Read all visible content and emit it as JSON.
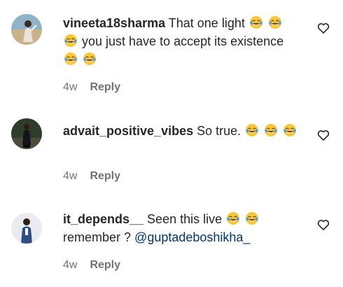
{
  "comments": [
    {
      "username": "vineeta18sharma",
      "segments": [
        {
          "t": "text",
          "v": " That one light "
        },
        {
          "t": "emoji",
          "name": "face-with-tears-of-joy"
        },
        {
          "t": "text",
          "v": " "
        },
        {
          "t": "emoji",
          "name": "face-with-tears-of-joy"
        },
        {
          "t": "text",
          "v": " "
        },
        {
          "t": "emoji",
          "name": "face-with-tears-of-joy"
        },
        {
          "t": "text",
          "v": " you just have to accept its existence "
        },
        {
          "t": "emoji",
          "name": "face-with-tears-of-joy"
        },
        {
          "t": "text",
          "v": " "
        },
        {
          "t": "emoji",
          "name": "face-with-tears-of-joy"
        }
      ],
      "time": "4w",
      "reply_label": "Reply",
      "like_icon": "heart-outline-icon"
    },
    {
      "username": "advait_positive_vibes",
      "segments": [
        {
          "t": "text",
          "v": " So true. "
        },
        {
          "t": "emoji",
          "name": "face-with-tears-of-joy"
        },
        {
          "t": "text",
          "v": " "
        },
        {
          "t": "emoji",
          "name": "face-with-tears-of-joy"
        },
        {
          "t": "text",
          "v": " "
        },
        {
          "t": "emoji",
          "name": "face-with-tears-of-joy"
        }
      ],
      "time": "4w",
      "reply_label": "Reply",
      "like_icon": "heart-outline-icon"
    },
    {
      "username": "it_depends__",
      "segments": [
        {
          "t": "text",
          "v": " Seen this live "
        },
        {
          "t": "emoji",
          "name": "face-with-tears-of-joy"
        },
        {
          "t": "text",
          "v": " "
        },
        {
          "t": "emoji",
          "name": "face-with-tears-of-joy"
        },
        {
          "t": "text",
          "v": " remember ? "
        },
        {
          "t": "mention",
          "v": "@guptadeboshikha_"
        }
      ],
      "time": "4w",
      "reply_label": "Reply",
      "like_icon": "heart-outline-icon"
    }
  ],
  "colors": {
    "text": "#262626",
    "meta": "#737373",
    "mention": "#00376b",
    "emoji_face": "#f8c73b"
  }
}
